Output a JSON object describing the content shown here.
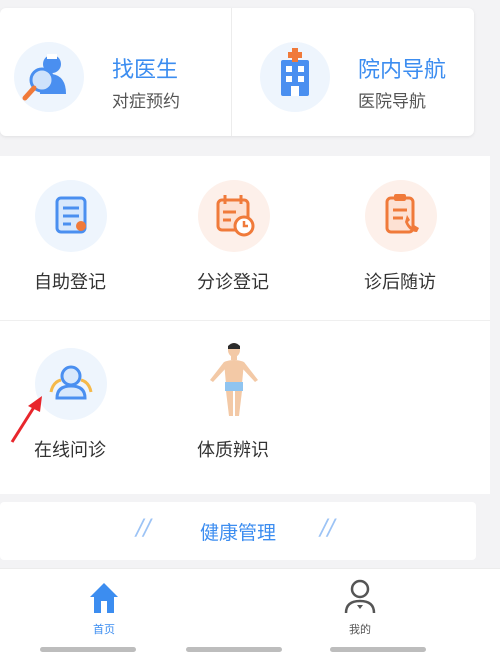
{
  "top_actions": [
    {
      "title": "找医生",
      "subtitle": "对症预约",
      "icon": "doctor-search-icon"
    },
    {
      "title": "院内导航",
      "subtitle": "医院导航",
      "icon": "hospital-building-icon"
    }
  ],
  "services": [
    {
      "label": "自助登记",
      "icon": "clipboard-form-icon"
    },
    {
      "label": "分诊登记",
      "icon": "calendar-clock-icon"
    },
    {
      "label": "诊后随访",
      "icon": "clipboard-phone-icon"
    },
    {
      "label": "在线问诊",
      "icon": "online-consult-icon"
    },
    {
      "label": "体质辨识",
      "icon": "human-body-icon"
    }
  ],
  "health_section": {
    "title": "健康管理"
  },
  "tabbar": [
    {
      "label": "首页",
      "icon": "home-icon",
      "active": true
    },
    {
      "label": "我的",
      "icon": "user-icon",
      "active": false
    }
  ],
  "colors": {
    "accent": "#3c8df0",
    "orange": "#f07a3a",
    "arrow": "#e8262c"
  }
}
